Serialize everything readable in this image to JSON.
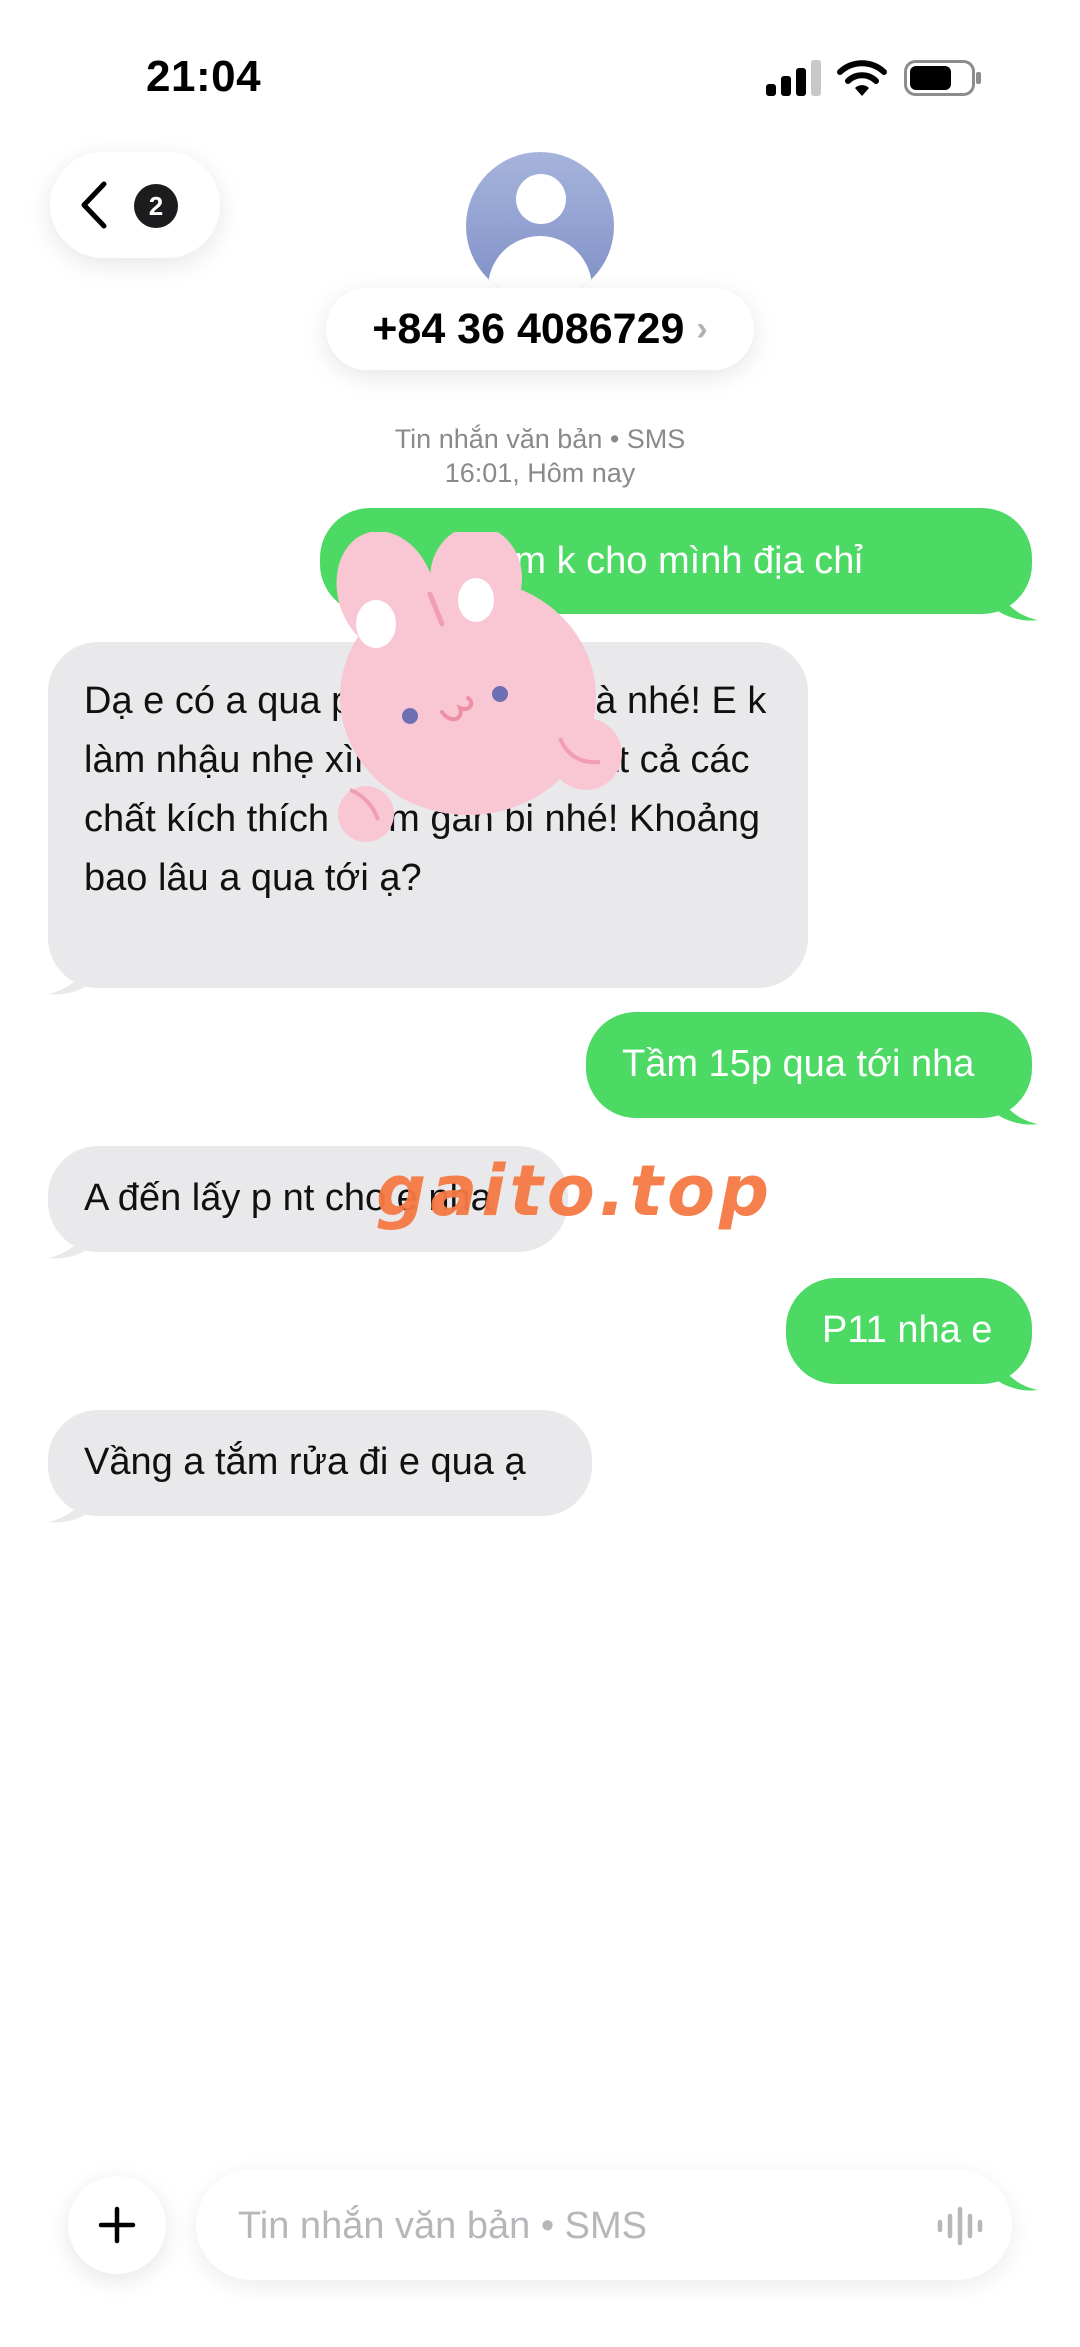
{
  "status_bar": {
    "time": "21:04",
    "battery_level": 0.7
  },
  "header": {
    "unread_count": "2",
    "contact": "+84 36 4086729",
    "contact_chevron": "›"
  },
  "conversation_meta": {
    "channel": "Tin nhắn văn bản • SMS",
    "timestamp": "16:01, Hôm nay"
  },
  "messages": [
    {
      "direction": "outgoing",
      "text": "Hi e có làm k cho mình địa chỉ"
    },
    {
      "direction": "incoming",
      "text": "Dạ e có a qua phú riềng đỏ nhà nhé! E k làm nhậu nhẹ xìn và sử dụng tất cả các chất kích thích chim gắn bi nhé! Khoảng bao lâu a qua tới ạ?"
    },
    {
      "direction": "outgoing",
      "text": "Tầm 15p qua tới nha"
    },
    {
      "direction": "incoming",
      "text": "A đến lấy p nt cho e nha"
    },
    {
      "direction": "outgoing",
      "text": "P11 nha e"
    },
    {
      "direction": "incoming",
      "text": "Vầng a tắm rửa đi e qua ạ"
    }
  ],
  "composer": {
    "placeholder": "Tin nhắn văn bản • SMS",
    "add_icon": "plus-icon",
    "voice_icon": "waveform-icon"
  },
  "overlay": {
    "watermark": "gaito.top",
    "sticker": "pink-bunny-sticker"
  },
  "colors": {
    "outgoing_bubble": "#4cd964",
    "incoming_bubble": "#e9e9eb",
    "meta_text": "#8a8a8e",
    "watermark": "#f57a45"
  }
}
